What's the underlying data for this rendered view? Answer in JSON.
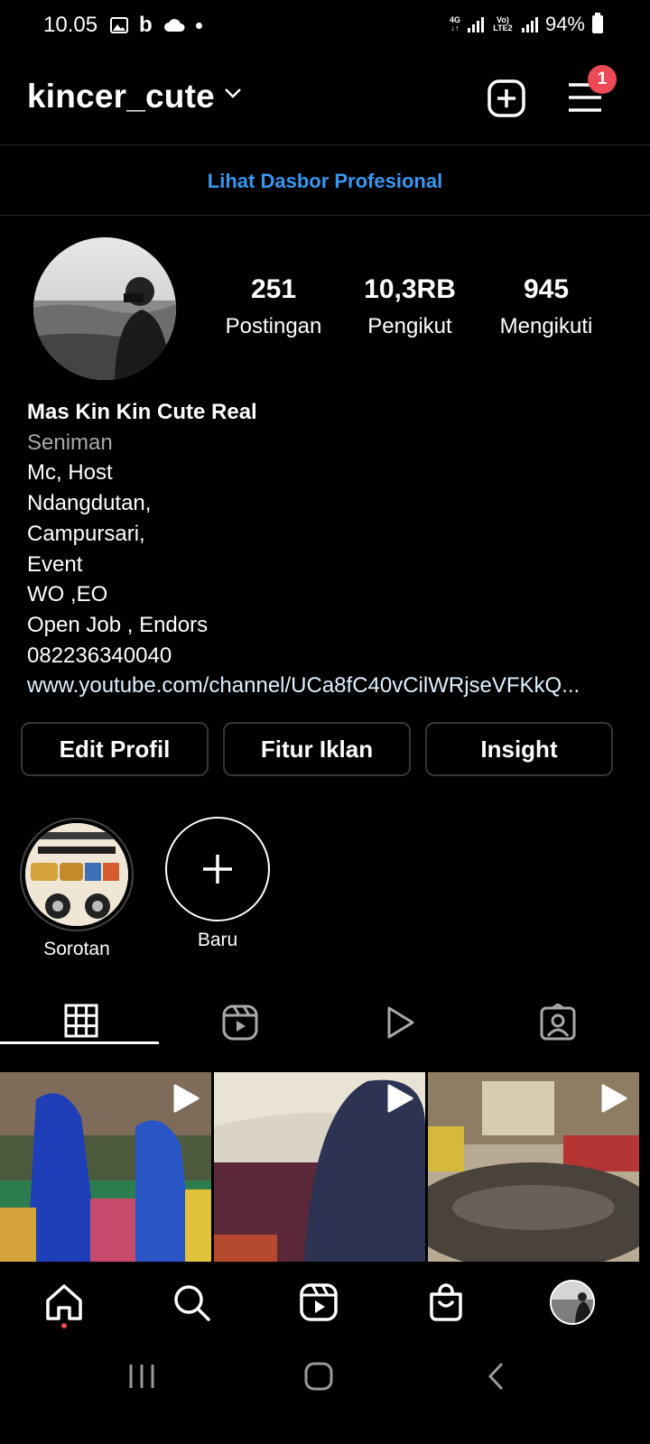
{
  "status_bar": {
    "time": "10.05",
    "net": "4G",
    "volte": "Vo) LTE2",
    "battery": "94%"
  },
  "header": {
    "username": "kincer_cute",
    "notification_count": "1"
  },
  "dashboard_link": "Lihat Dasbor Profesional",
  "stats": [
    {
      "value": "251",
      "label": "Postingan"
    },
    {
      "value": "10,3RB",
      "label": "Pengikut"
    },
    {
      "value": "945",
      "label": "Mengikuti"
    }
  ],
  "bio": {
    "name": "Mas Kin Kin Cute Real",
    "category": "Seniman",
    "lines": [
      "Mc, Host",
      "Ndangdutan,",
      "Campursari,",
      "Event",
      "WO ,EO",
      "Open Job , Endors",
      "082236340040"
    ],
    "link": "www.youtube.com/channel/UCa8fC40vCilWRjseVFKkQ..."
  },
  "buttons": {
    "edit": "Edit Profil",
    "ads": "Fitur Iklan",
    "insight": "Insight"
  },
  "highlights": [
    {
      "label": "Sorotan"
    },
    {
      "label": "Baru"
    }
  ],
  "tabs": [
    "grid-icon",
    "reels-icon",
    "video-icon",
    "tagged-icon"
  ],
  "bottom_nav": [
    "home-icon",
    "search-icon",
    "reels-icon",
    "shop-icon",
    "profile-avatar"
  ],
  "colors": {
    "accent": "#3897f0",
    "badge": "#ed4956",
    "border": "#363636",
    "muted": "#a8a8a8"
  }
}
